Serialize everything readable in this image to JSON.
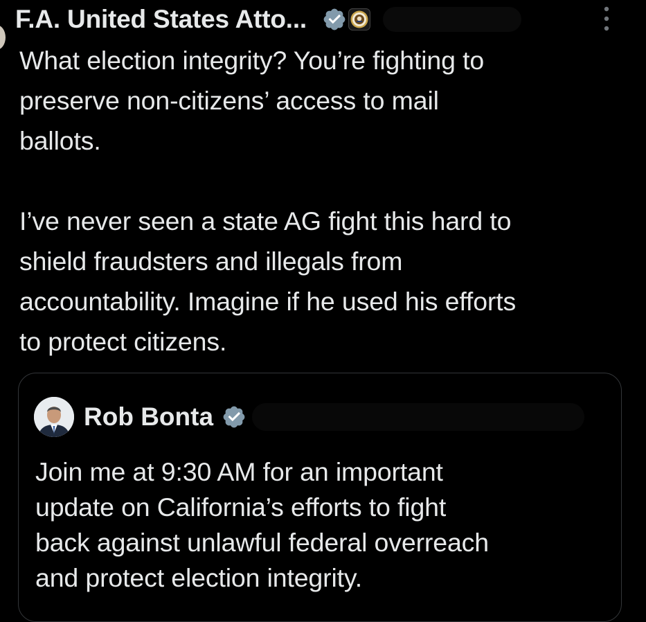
{
  "tweet": {
    "author": {
      "display_name": "F.A. United States Atto...",
      "verified": true,
      "affiliation_badge": "doj-seal-icon",
      "handle_redacted": true
    },
    "text_lines": [
      "What election integrity? You’re fighting to",
      "preserve non-citizens’ access to mail",
      "ballots.",
      "",
      "I’ve never seen a state AG fight this hard to",
      "shield fraudsters and illegals from",
      "accountability. Imagine if he used his efforts",
      "to protect citizens."
    ],
    "more_icon": "more-vertical-icon"
  },
  "quote": {
    "author": {
      "display_name": "Rob Bonta",
      "verified": true,
      "handle_redacted": true
    },
    "text_lines": [
      "Join me at 9:30 AM for an important",
      "update on California’s efforts to fight",
      "back against unlawful federal overreach",
      "and protect election integrity."
    ]
  },
  "colors": {
    "background": "#000000",
    "text": "#e7e9ea",
    "verified_badge": "#829aab",
    "border": "#333639"
  }
}
